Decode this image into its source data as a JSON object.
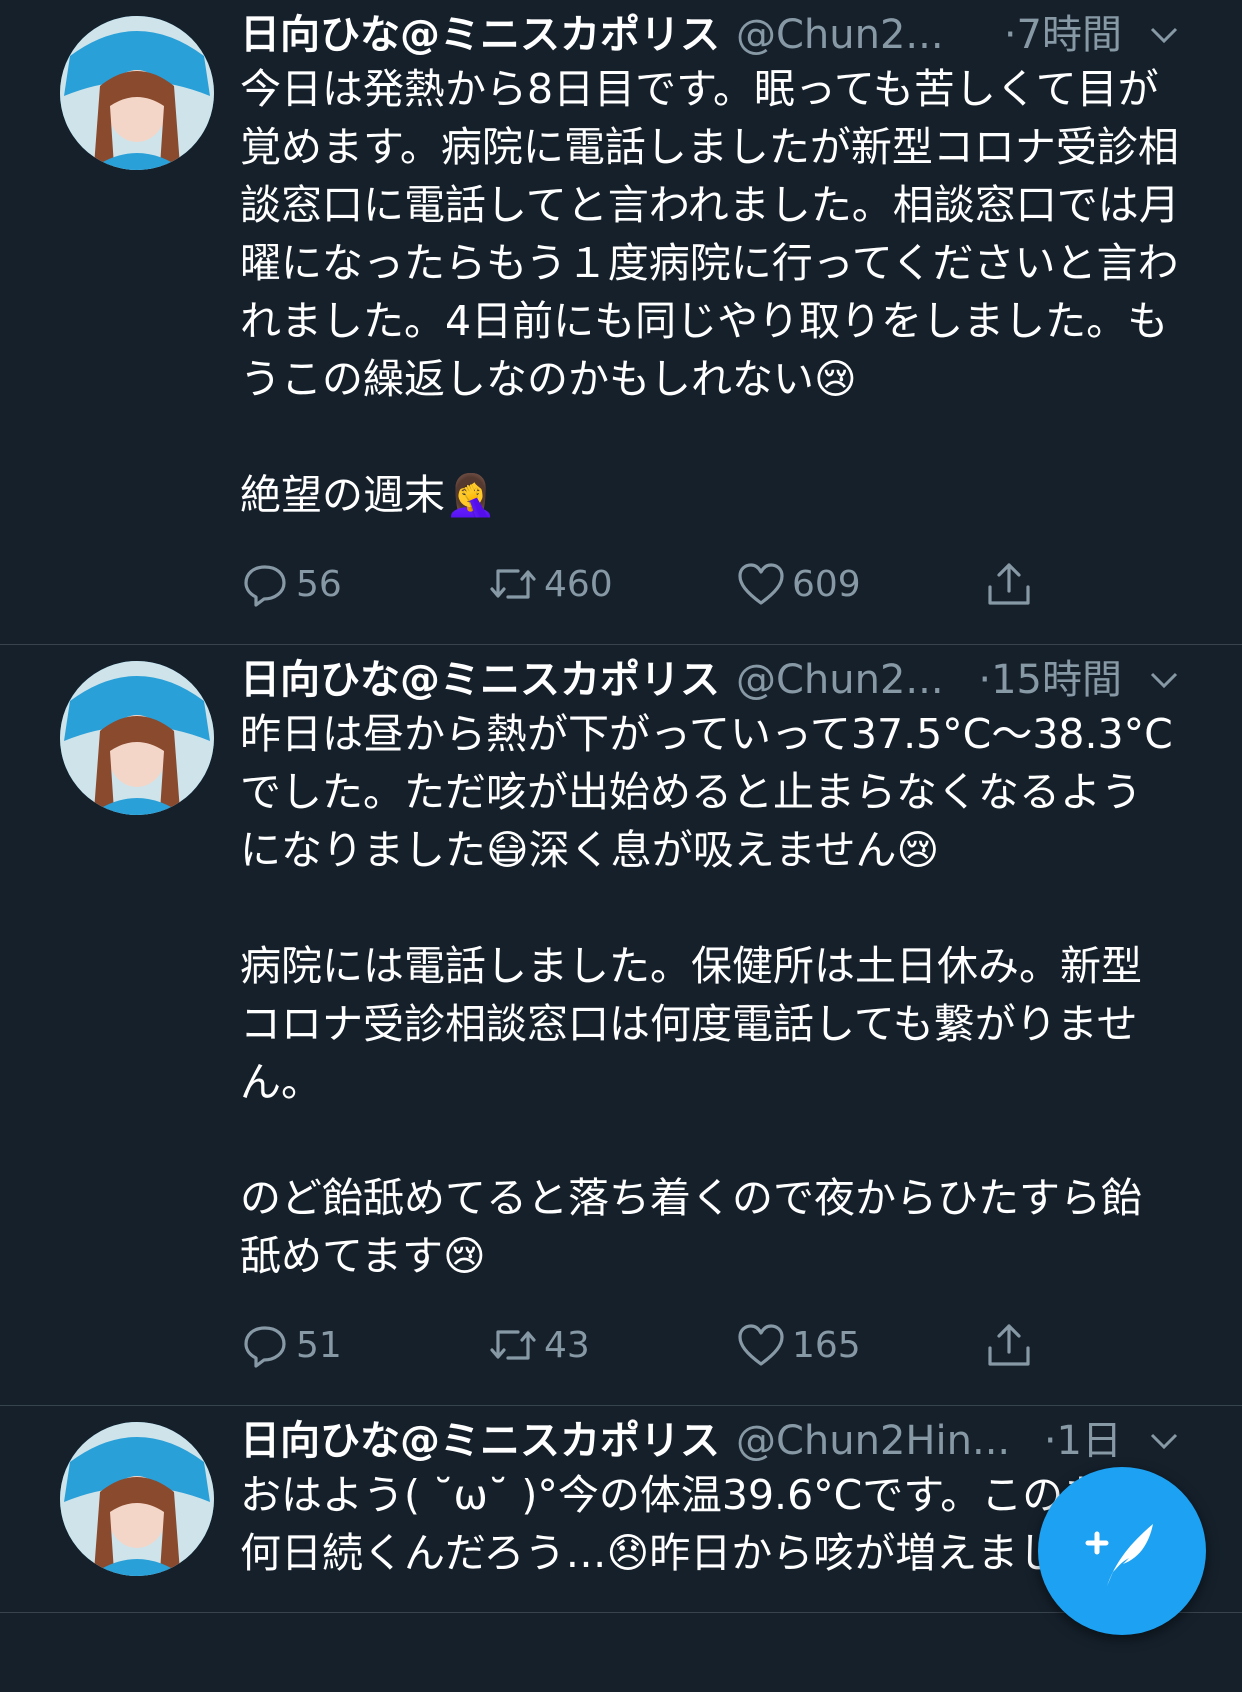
{
  "tweets": [
    {
      "name": "日向ひな@ミニスカポリス",
      "handle": "@Chun2...",
      "time": "·7時間",
      "text": "今日は発熱から8日目です。眠っても苦しくて目が覚めます。病院に電話しましたが新型コロナ受診相談窓口に電話してと言われました。相談窓口では月曜になったらもう１度病院に行ってくださいと言われました。4日前にも同じやり取りをしました。もうこの繰返しなのかもしれない😢\n\n絶望の週末🤦‍♀️",
      "replies": "56",
      "retweets": "460",
      "likes": "609"
    },
    {
      "name": "日向ひな@ミニスカポリス",
      "handle": "@Chun2...",
      "time": "·15時間",
      "text": "昨日は昼から熱が下がっていって37.5°C〜38.3°Cでした。ただ咳が出始めると止まらなくなるようになりました😷深く息が吸えません😢\n\n病院には電話しました。保健所は土日休み。新型コロナ受診相談窓口は何度電話しても繋がりません。\n\nのど飴舐めてると落ち着くので夜からひたすら飴舐めてます😢",
      "replies": "51",
      "retweets": "43",
      "likes": "165"
    },
    {
      "name": "日向ひな@ミニスカポリス",
      "handle": "@Chun2Hin...",
      "time": "·1日",
      "text": "おはよう( ˘ω˘ )°今の体温39.6°Cです。このあと何日続くんだろう…😞昨日から咳が増えました😷"
    }
  ],
  "icons": {
    "reply": "reply-icon",
    "retweet": "retweet-icon",
    "like": "heart-icon",
    "share": "share-icon",
    "compose": "compose-tweet-icon",
    "caret": "chevron-down-icon"
  },
  "colors": {
    "background": "#15202b",
    "secondary_text": "#8899a6",
    "divider": "#38444d",
    "accent": "#1da1f2"
  }
}
